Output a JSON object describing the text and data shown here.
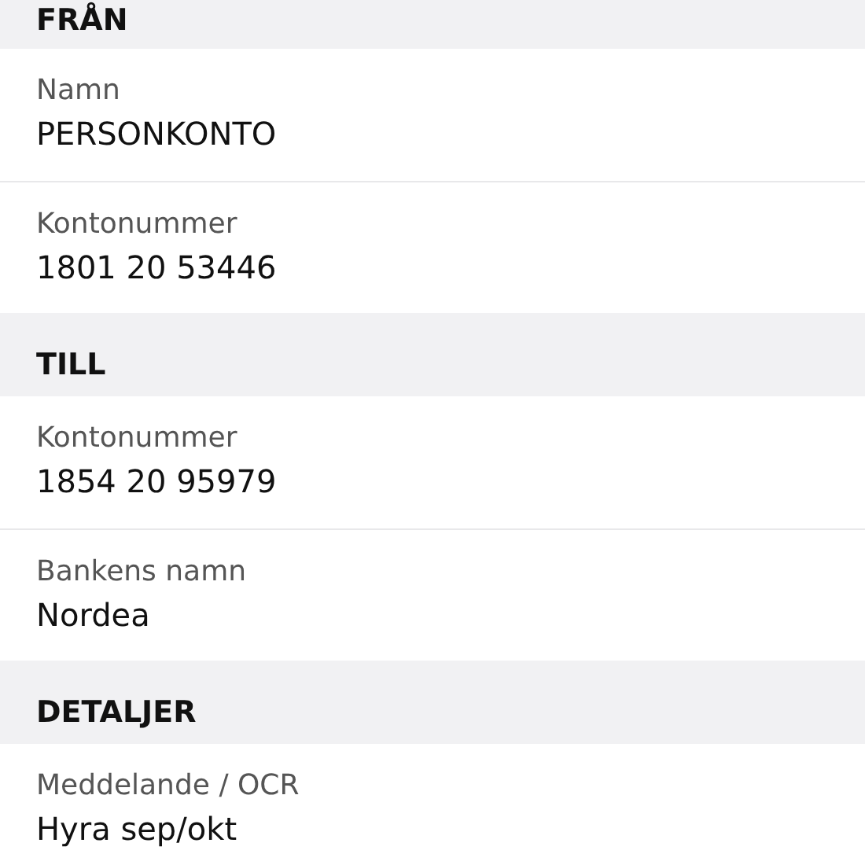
{
  "sections": [
    {
      "title": "FRÅN",
      "fields": [
        {
          "label": "Namn",
          "value": "PERSONKONTO"
        },
        {
          "label": "Kontonummer",
          "value": "1801 20 53446"
        }
      ]
    },
    {
      "title": "TILL",
      "fields": [
        {
          "label": "Kontonummer",
          "value": "1854 20 95979"
        },
        {
          "label": "Bankens namn",
          "value": "Nordea"
        }
      ]
    },
    {
      "title": "DETALJER",
      "fields": [
        {
          "label": "Meddelande / OCR",
          "value": "Hyra sep/okt"
        }
      ]
    }
  ]
}
